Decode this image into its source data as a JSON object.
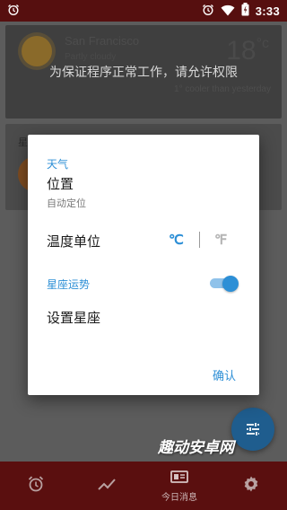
{
  "status_bar": {
    "time": "3:33",
    "icons": [
      "alarm-icon",
      "alarm-clock-icon",
      "wifi-icon",
      "battery-icon"
    ]
  },
  "weather": {
    "city": "San Francisco",
    "condition": "Partly cloudy",
    "temperature": "18",
    "unit": "°c",
    "compare_text": "1° cooler than yesterday"
  },
  "permission_message": "为保证程序正常工作，请允许权限",
  "star_card": {
    "title": "星座运势"
  },
  "dialog": {
    "weather_section": "天气",
    "location_label": "位置",
    "location_value": "自动定位",
    "temp_unit_label": "温度单位",
    "unit_celsius": "℃",
    "unit_fahrenheit": "℉",
    "horoscope_section": "星座运势",
    "horoscope_enabled": true,
    "set_zodiac_label": "设置星座",
    "confirm_label": "确认"
  },
  "watermark": "趣动安卓网",
  "bottom_nav": {
    "items": [
      {
        "icon": "alarm-icon",
        "label": ""
      },
      {
        "icon": "trend-icon",
        "label": ""
      },
      {
        "icon": "news-icon",
        "label": "今日消息"
      },
      {
        "icon": "settings-icon",
        "label": ""
      }
    ]
  },
  "colors": {
    "accent": "#2d8fd6",
    "status_bar": "#560f0f",
    "bottom_nav": "#5a0f0f",
    "dialog_bg": "#ffffff"
  }
}
